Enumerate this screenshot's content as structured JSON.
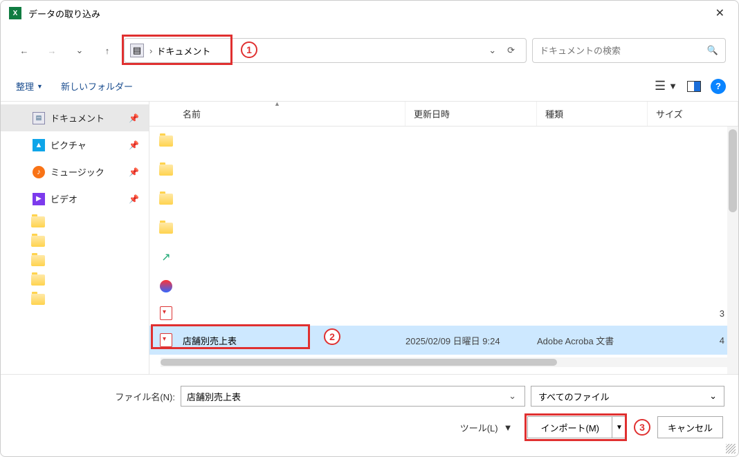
{
  "window": {
    "title": "データの取り込み"
  },
  "breadcrumb": {
    "location": "ドキュメント"
  },
  "search": {
    "placeholder": "ドキュメントの検索"
  },
  "toolbar": {
    "organize": "整理",
    "new_folder": "新しいフォルダー"
  },
  "columns": {
    "name": "名前",
    "date": "更新日時",
    "type": "種類",
    "size": "サイズ"
  },
  "sidebar": {
    "items": [
      {
        "label": "ドキュメント"
      },
      {
        "label": "ピクチャ"
      },
      {
        "label": "ミュージック"
      },
      {
        "label": "ビデオ"
      }
    ]
  },
  "selected_file": {
    "name": "店舗別売上表",
    "date": "2025/02/09 日曜日 9:24",
    "type": "Adobe Acroba 文書",
    "size": "4"
  },
  "partial_size": "3",
  "filename_label": "ファイル名(N):",
  "filename_value": "店舗別売上表",
  "filter_label": "すべてのファイル",
  "tools_label": "ツール(L)",
  "import_label": "インポート(M)",
  "cancel_label": "キャンセル",
  "annotations": {
    "n1": "1",
    "n2": "2",
    "n3": "3"
  }
}
